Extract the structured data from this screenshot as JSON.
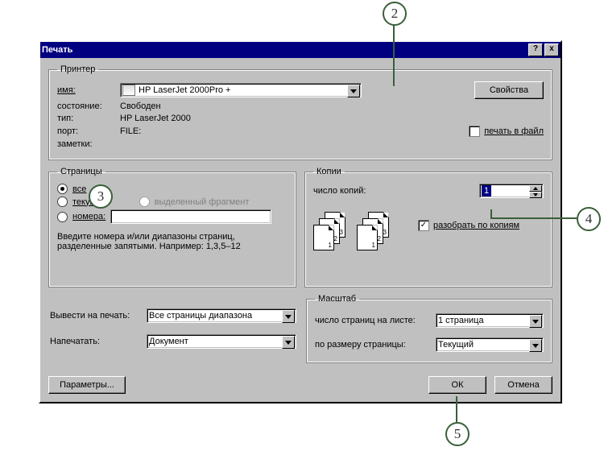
{
  "callouts": {
    "c2": "2",
    "c3": "3",
    "c4": "4",
    "c5": "5"
  },
  "title": "Печать",
  "titlebar": {
    "help": "?",
    "close": "x"
  },
  "printer_group": {
    "legend": "Принтер",
    "name_label": "имя:",
    "name_value": "HP LaserJet 2000Pro +",
    "properties_btn": "Свойства",
    "status_label": "состояние:",
    "status_value": "Свободен",
    "type_label": "тип:",
    "type_value": "HP LaserJet 2000",
    "port_label": "порт:",
    "port_value": "FILE:",
    "notes_label": "заметки:",
    "print_to_file": "печать в файл"
  },
  "pages_group": {
    "legend": "Страницы",
    "all": "все",
    "current": "текущая",
    "selection": "выделенный фрагмент",
    "numbers": "номера:",
    "hint": "Введите номера и/или диапазоны страниц, разделенные запятыми. Например: 1,3,5–12"
  },
  "copies_group": {
    "legend": "Копии",
    "count_label": "число копий:",
    "count_value": "1",
    "collate": "разобрать по копиям"
  },
  "print_what": {
    "include_label": "Вывести на печать:",
    "include_value": "Все страницы диапазона",
    "print_label": "Напечатать:",
    "print_value": "Документ"
  },
  "scale_group": {
    "legend": "Масштаб",
    "pages_per_sheet_label": "число страниц на листе:",
    "pages_per_sheet_value": "1 страница",
    "fit_label": "по размеру страницы:",
    "fit_value": "Текущий"
  },
  "buttons": {
    "options": "Параметры...",
    "ok": "ОК",
    "cancel": "Отмена"
  },
  "collate_pages": {
    "p1": "1",
    "p2": "2",
    "p3": "3"
  }
}
